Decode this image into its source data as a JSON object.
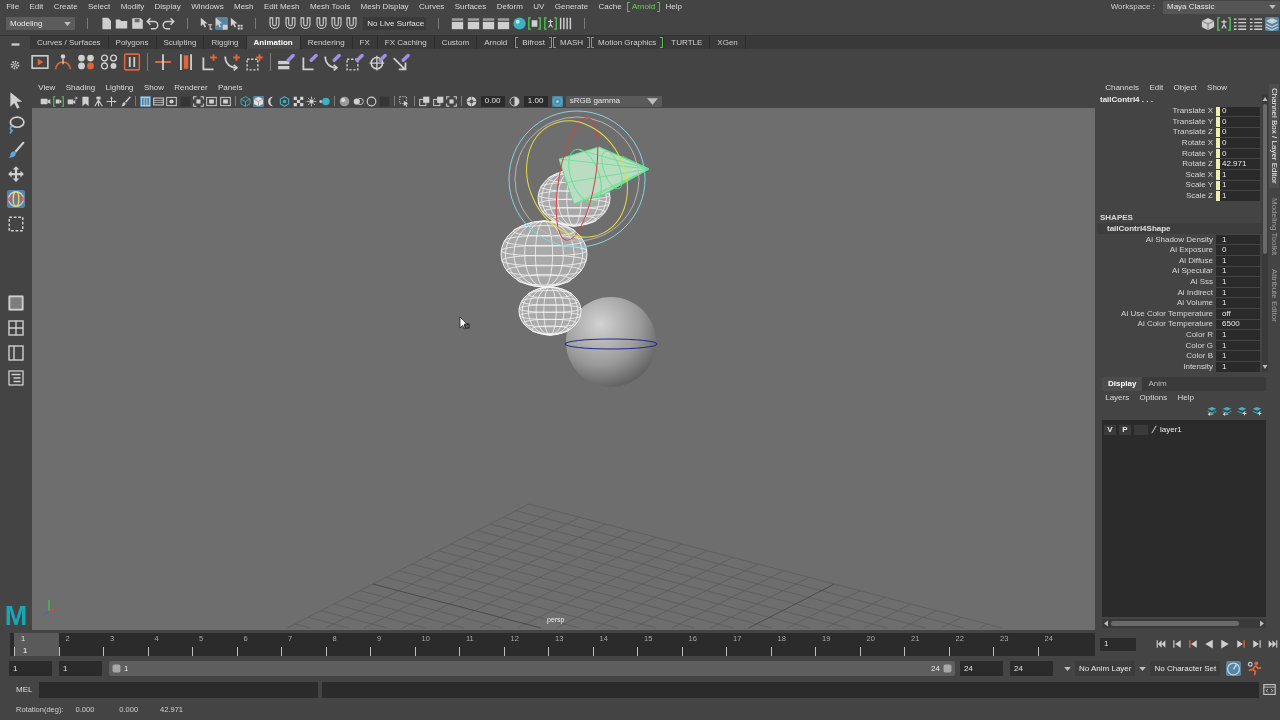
{
  "menu_bar": {
    "items": [
      {
        "label": "File",
        "plugin": false
      },
      {
        "label": "Edit",
        "plugin": false
      },
      {
        "label": "Create",
        "plugin": false
      },
      {
        "label": "Select",
        "plugin": false
      },
      {
        "label": "Modify",
        "plugin": false
      },
      {
        "label": "Display",
        "plugin": false
      },
      {
        "label": "Windows",
        "plugin": false
      },
      {
        "label": "Mesh",
        "plugin": false
      },
      {
        "label": "Edit Mesh",
        "plugin": false
      },
      {
        "label": "Mesh Tools",
        "plugin": false
      },
      {
        "label": "Mesh Display",
        "plugin": false
      },
      {
        "label": "Curves",
        "plugin": false
      },
      {
        "label": "Surfaces",
        "plugin": false
      },
      {
        "label": "Deform",
        "plugin": false
      },
      {
        "label": "UV",
        "plugin": false
      },
      {
        "label": "Generate",
        "plugin": false
      },
      {
        "label": "Cache",
        "plugin": false
      },
      {
        "label": "Arnold",
        "plugin": true
      },
      {
        "label": "Help",
        "plugin": false
      }
    ]
  },
  "workspace": {
    "label": "Workspace :",
    "value": "Maya Classic"
  },
  "status_line": {
    "mode": "Modeling",
    "file_tools": [
      {
        "kind": "page"
      },
      {
        "kind": "folder"
      },
      {
        "kind": "disk"
      },
      {
        "kind": "undo-arrow"
      },
      {
        "kind": "redo-arrow"
      }
    ],
    "selection_modes": [
      {
        "kind": "hierarchy-cursor",
        "selected": false
      },
      {
        "kind": "object-cursor",
        "selected": true
      },
      {
        "kind": "component-cursor",
        "selected": false
      }
    ],
    "snap_tools": [
      {
        "kind": "magnet",
        "selected": false
      },
      {
        "kind": "magnet",
        "selected": false
      },
      {
        "kind": "magnet",
        "selected": false
      },
      {
        "kind": "magnet",
        "selected": false
      },
      {
        "kind": "magnet",
        "selected": false
      },
      {
        "kind": "magnet",
        "selected": false
      }
    ],
    "live_surface": "No Live Surface",
    "render_tools": [
      {
        "kind": "clapper"
      },
      {
        "kind": "clapper"
      },
      {
        "kind": "clapper"
      },
      {
        "kind": "clapper"
      },
      {
        "kind": "ball"
      },
      {
        "kind": "bracket-picture"
      },
      {
        "kind": "bracket-figure"
      },
      {
        "kind": "bars"
      }
    ],
    "panel_toggles": [
      {
        "kind": "cube-stack",
        "selected": false
      },
      {
        "kind": "bracket-figure",
        "selected": false
      },
      {
        "kind": "list-lines",
        "selected": false
      },
      {
        "kind": "list-lines",
        "selected": false
      },
      {
        "kind": "layer-stack",
        "selected": true
      }
    ]
  },
  "shelf": {
    "tabs": [
      {
        "label": "Curves / Surfaces",
        "selected": false,
        "plugin": false
      },
      {
        "label": "Polygons",
        "selected": false,
        "plugin": false
      },
      {
        "label": "Sculpting",
        "selected": false,
        "plugin": false
      },
      {
        "label": "Rigging",
        "selected": false,
        "plugin": false
      },
      {
        "label": "Animation",
        "selected": true,
        "plugin": false
      },
      {
        "label": "Rendering",
        "selected": false,
        "plugin": false
      },
      {
        "label": "FX",
        "selected": false,
        "plugin": false
      },
      {
        "label": "FX Caching",
        "selected": false,
        "plugin": false
      },
      {
        "label": "Custom",
        "selected": false,
        "plugin": false
      },
      {
        "label": "Arnold",
        "selected": false,
        "plugin": false
      },
      {
        "label": "Bifrost",
        "selected": false,
        "plugin": true
      },
      {
        "label": "MASH",
        "selected": false,
        "plugin": true
      },
      {
        "label": "Motion Graphics",
        "selected": false,
        "plugin": true
      },
      {
        "label": "TURTLE",
        "selected": false,
        "plugin": false
      },
      {
        "label": "XGen",
        "selected": false,
        "plugin": false
      }
    ],
    "tool_groups": [
      [
        {
          "kind": "film-play"
        },
        {
          "kind": "arc-dots"
        },
        {
          "kind": "dots"
        },
        {
          "kind": "dots-outline"
        },
        {
          "kind": "boxed-bars"
        }
      ],
      [
        {
          "kind": "cross-line"
        },
        {
          "kind": "double-bar"
        },
        {
          "kind": "axes-plus"
        },
        {
          "kind": "curve-plus"
        },
        {
          "kind": "dashed-plus"
        }
      ],
      [
        {
          "kind": "stack-link"
        },
        {
          "kind": "axes-link"
        },
        {
          "kind": "curve-link"
        },
        {
          "kind": "dashed-link"
        },
        {
          "kind": "target-link"
        },
        {
          "kind": "diagonal-link"
        }
      ]
    ]
  },
  "toolbox": {
    "tools": [
      {
        "kind": "arrow-cursor",
        "selected": false
      },
      {
        "kind": "lasso",
        "selected": false
      },
      {
        "kind": "paint-brush",
        "selected": false
      },
      {
        "kind": "move-arrows",
        "selected": false
      },
      {
        "kind": "rotate-sphere",
        "selected": true
      },
      {
        "kind": "dashed-square",
        "selected": false
      }
    ],
    "layouts": [
      {
        "kind": "single-pane",
        "selected": true
      },
      {
        "kind": "four-pane",
        "selected": false
      },
      {
        "kind": "two-pane",
        "selected": false
      },
      {
        "kind": "outliner-list",
        "selected": false
      }
    ],
    "logo": "M"
  },
  "viewport": {
    "menu": [
      "View",
      "Shading",
      "Lighting",
      "Show",
      "Renderer",
      "Panels"
    ],
    "toolbar_groups": [
      [
        {
          "kind": "camera",
          "selected": false
        },
        {
          "kind": "bracket-camera",
          "selected": false
        },
        {
          "kind": "camera-arrows",
          "selected": false
        },
        {
          "kind": "bookmark",
          "selected": false
        },
        {
          "kind": "tripod",
          "selected": false
        },
        {
          "kind": "pivot-arrows",
          "selected": false
        },
        {
          "kind": "brush",
          "selected": false
        }
      ],
      [
        {
          "kind": "grid-lines",
          "selected": true
        },
        {
          "kind": "film-gate",
          "selected": false
        },
        {
          "kind": "circle-frame",
          "selected": false
        },
        {
          "kind": "dark-square",
          "selected": false
        },
        {
          "kind": "frame-corners",
          "selected": false
        },
        {
          "kind": "frame-box",
          "selected": false
        },
        {
          "kind": "frame-box",
          "selected": false
        }
      ],
      [
        {
          "kind": "wire-cube",
          "selected": false
        },
        {
          "kind": "shaded-cube",
          "selected": true
        },
        {
          "kind": "half-moon",
          "selected": false
        },
        {
          "kind": "hexagon",
          "selected": false
        },
        {
          "kind": "checker",
          "selected": false
        },
        {
          "kind": "sun",
          "selected": false
        },
        {
          "kind": "ball-dot",
          "selected": false
        }
      ],
      [
        {
          "kind": "shaded-ball",
          "selected": false
        },
        {
          "kind": "twin-circles",
          "selected": false
        },
        {
          "kind": "ring",
          "selected": false
        },
        {
          "kind": "dark-square",
          "selected": false
        }
      ],
      [
        {
          "kind": "cursor-box",
          "selected": false
        }
      ],
      [
        {
          "kind": "overlap-squares",
          "selected": false
        },
        {
          "kind": "overlap-squares",
          "selected": false
        },
        {
          "kind": "frame-corners",
          "selected": false
        }
      ]
    ],
    "exposure": "0.00",
    "gamma": "1.00",
    "color_management": {
      "selected": true,
      "value": "sRGB gamma"
    },
    "camera": "persp"
  },
  "channel_box": {
    "menu": [
      "Channels",
      "Edit",
      "Object",
      "Show"
    ],
    "object": "tailContrl4 . . .",
    "attributes": [
      {
        "label": "Translate X",
        "value": "0",
        "color": "#eeeeb0"
      },
      {
        "label": "Translate Y",
        "value": "0",
        "color": "#eeeeb0"
      },
      {
        "label": "Translate Z",
        "value": "0",
        "color": "#eeeeb0"
      },
      {
        "label": "Rotate X",
        "value": "0",
        "color": "#eeeeb0"
      },
      {
        "label": "Rotate Y",
        "value": "0",
        "color": "#eeeeb0"
      },
      {
        "label": "Rotate Z",
        "value": "42.971",
        "color": "#eeeeb0"
      },
      {
        "label": "Scale X",
        "value": "1",
        "color": "#eeeeb0"
      },
      {
        "label": "Scale Y",
        "value": "1",
        "color": "#eeeeb0"
      },
      {
        "label": "Scale Z",
        "value": "1",
        "color": "#eeeeb0"
      }
    ],
    "shapes_title": "SHAPES",
    "shape_name": "tailContrl4Shape",
    "shape_attributes": [
      {
        "label": "Ai Shadow Density",
        "value": "1"
      },
      {
        "label": "Ai Exposure",
        "value": "0"
      },
      {
        "label": "Ai Diffuse",
        "value": "1"
      },
      {
        "label": "Ai Specular",
        "value": "1"
      },
      {
        "label": "Ai Sss",
        "value": "1"
      },
      {
        "label": "Ai Indirect",
        "value": "1"
      },
      {
        "label": "Ai Volume",
        "value": "1"
      },
      {
        "label": "Ai Use Color Temperature",
        "value": "off"
      },
      {
        "label": "Ai Color Temperature",
        "value": "6500"
      },
      {
        "label": "Color R",
        "value": "1"
      },
      {
        "label": "Color G",
        "value": "1"
      },
      {
        "label": "Color B",
        "value": "1"
      },
      {
        "label": "Intensity",
        "value": "1"
      }
    ]
  },
  "layer_editor": {
    "tabs": [
      {
        "label": "Display",
        "selected": true
      },
      {
        "label": "Anim",
        "selected": false
      }
    ],
    "menu": [
      "Layers",
      "Options",
      "Help"
    ],
    "tools": [
      {
        "kind": "layers-arrow"
      },
      {
        "kind": "layers-arrow"
      },
      {
        "kind": "layers-plus"
      },
      {
        "kind": "layers-plus"
      }
    ],
    "layers": [
      {
        "visibility": "V",
        "playback": "P",
        "name": "layer1"
      }
    ]
  },
  "side_tabs": [
    {
      "label": "Channel Box / Layer Editor",
      "selected": true
    },
    {
      "label": "Modeling Toolkit",
      "selected": false
    },
    {
      "label": "Attribute Editor",
      "selected": false
    }
  ],
  "timeline": {
    "frames": [
      {
        "label": "1",
        "selected": true
      },
      {
        "label": "2",
        "selected": false
      },
      {
        "label": "3",
        "selected": false
      },
      {
        "label": "4",
        "selected": false
      },
      {
        "label": "5",
        "selected": false
      },
      {
        "label": "6",
        "selected": false
      },
      {
        "label": "7",
        "selected": false
      },
      {
        "label": "8",
        "selected": false
      },
      {
        "label": "9",
        "selected": false
      },
      {
        "label": "10",
        "selected": false
      },
      {
        "label": "11",
        "selected": false
      },
      {
        "label": "12",
        "selected": false
      },
      {
        "label": "13",
        "selected": false
      },
      {
        "label": "14",
        "selected": false
      },
      {
        "label": "15",
        "selected": false
      },
      {
        "label": "16",
        "selected": false
      },
      {
        "label": "17",
        "selected": false
      },
      {
        "label": "18",
        "selected": false
      },
      {
        "label": "19",
        "selected": false
      },
      {
        "label": "20",
        "selected": false
      },
      {
        "label": "21",
        "selected": false
      },
      {
        "label": "22",
        "selected": false
      },
      {
        "label": "23",
        "selected": false
      },
      {
        "label": "24",
        "selected": false
      }
    ],
    "current_frame": "1",
    "frame_field": "1",
    "playback": [
      {
        "kind": "skip-start"
      },
      {
        "kind": "step-back"
      },
      {
        "kind": "prev-key"
      },
      {
        "kind": "play-back"
      },
      {
        "kind": "play-forward"
      },
      {
        "kind": "next-key"
      },
      {
        "kind": "step-forward"
      },
      {
        "kind": "skip-end"
      }
    ]
  },
  "range_slider": {
    "min": "1",
    "start": "1",
    "slider_start": "1",
    "slider_end": "24",
    "end": "24",
    "max": "24",
    "anim_layer": "No Anim Layer",
    "character_set": "No Character Set",
    "toggles": [
      {
        "kind": "gauge",
        "selected": true
      },
      {
        "kind": "running-figure",
        "selected": false
      }
    ]
  },
  "command_line": {
    "language": "MEL"
  },
  "help_line": {
    "label": "Rotation(deg):",
    "values": [
      "0.000",
      "0.000",
      "42.971"
    ]
  }
}
